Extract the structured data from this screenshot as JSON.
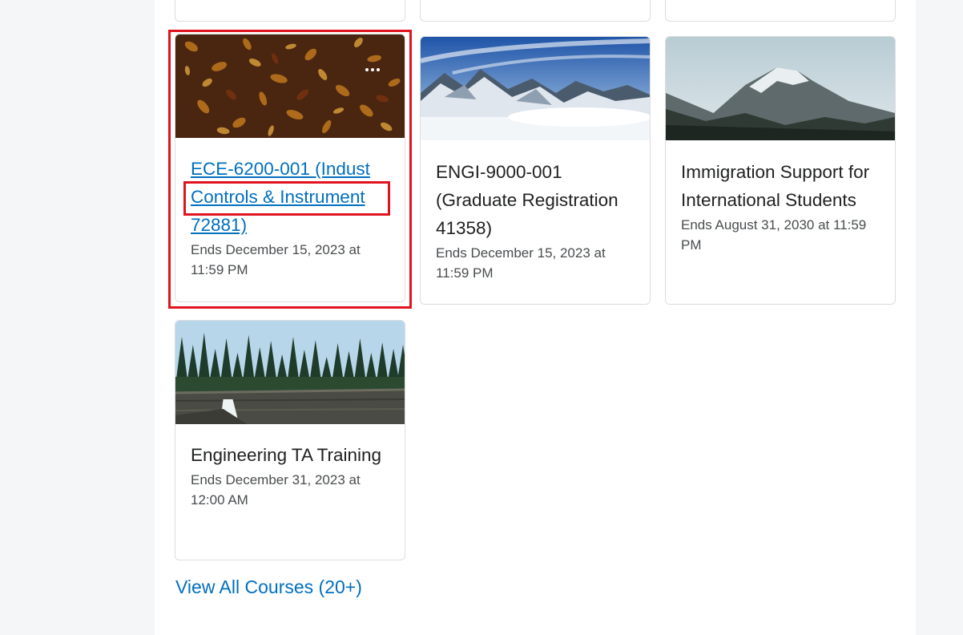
{
  "courses": [
    {
      "title": "ECE-6200-001 (Indust Controls & Instrument 72881)",
      "end": "Ends December 15, 2023 at 11:59 PM",
      "image": "autumn-leaves"
    },
    {
      "title": "ENGI-9000-001 (Graduate Registration 41358)",
      "end": "Ends December 15, 2023 at 11:59 PM",
      "image": "snowy-mountains"
    },
    {
      "title": "Immigration Support for International Students",
      "end": "Ends August 31, 2030 at 11:59 PM",
      "image": "rocky-peak"
    },
    {
      "title": "Engineering TA Training",
      "end": "Ends December 31, 2023 at 12:00 AM",
      "image": "forest-waterfall"
    }
  ],
  "card_menu": {
    "icon": "more-options-icon"
  },
  "view_all_label": "View All Courses (20+)",
  "colors": {
    "link": "#006fbf",
    "highlight": "#e0141e",
    "text": "#202122",
    "muted": "#494c4e"
  }
}
